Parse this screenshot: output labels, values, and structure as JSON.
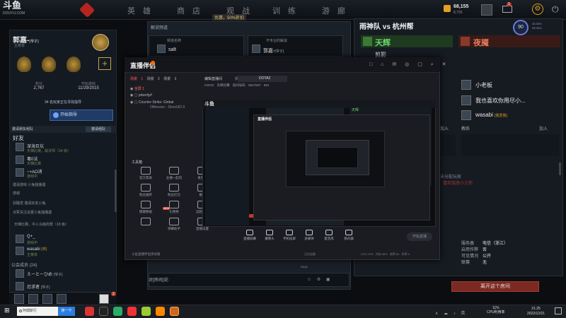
{
  "topbar": {
    "logo": "斗鱼",
    "logo_url": "DOUYU.COM",
    "nav": [
      "英 雄",
      "商 店",
      "观 战",
      "训 练",
      "游 廊"
    ],
    "notice": "优惠，50%折扣",
    "gold_value": "68,155",
    "gold_sub": "8,755",
    "settings_glyph": "⚙",
    "power_glyph": "⏻",
    "mail_count": "1"
  },
  "profile": {
    "name": "郭嘉-",
    "tag": "[爷子]",
    "subtitle": "主菜单",
    "stats": [
      {
        "label": "积分",
        "value": "2,767"
      },
      {
        "label": "开始游戏",
        "value": "11/29/2015"
      }
    ],
    "find_banner": "34 名玩家正在寻找指导",
    "coach_button": "开始指导",
    "friends_bar": "邀请朋友组队",
    "friends_button": "邀请组队",
    "friends_heading": "好友",
    "friends": [
      {
        "name": "深海巨坑",
        "status": "天梯比赛，敌法师（34 级）"
      },
      {
        "name": "毒0法",
        "status": "天梯比赛"
      },
      {
        "name": "~+AO消",
        "status": "游戏中"
      }
    ],
    "blurred": [
      "邀请游戏 小兔独播遇",
      "感谢",
      "别睡觉 邀请好友小兔",
      "点赞关注设置小兔独播遇"
    ],
    "friends_lower": [
      {
        "name": "Q+_",
        "status": "游戏中"
      },
      {
        "name": "wasabi",
        "tag": "[爷]",
        "status": "主菜单"
      }
    ],
    "party_label": "公会成员 (24)",
    "members": [
      {
        "name": "えーとーひめ",
        "tag": "[爷子]"
      },
      {
        "name": "忍求者",
        "tag": "[爷子]"
      }
    ],
    "lower_row": "天梯比赛，中入马级的帮（18 级）",
    "slot_badge": "2"
  },
  "lobby": {
    "title": "解说频道",
    "box1_label": "频道名称",
    "box1_value": "salt",
    "box2_label": "不专业的解说",
    "box2_value": "郭嘉-",
    "box2_tag": "[爷子]",
    "chat_label": "对[房间]说:",
    "chat_icons": "☺ ⚙ ▣"
  },
  "teams": {
    "match_title": "雨神队 vs 杭州帮",
    "radiant": "天辉",
    "dire": "夜魇",
    "radiant_player": "剪影",
    "score": "90",
    "score_side": [
      "36.98%",
      "98.06%"
    ],
    "dire_players": [
      {
        "name": "小老板",
        "tag": ""
      },
      {
        "name": "我也喜欢你用尽小...",
        "tag": ""
      },
      {
        "name": "wasabi",
        "tag": "[我爱我]"
      }
    ],
    "join_label": "加入",
    "coach_label": "教练",
    "unassigned": "未分配玩家",
    "unassigned_sub": "喜欢我改小三你",
    "info": [
      {
        "label": "服务器",
        "value": "电信（浙江）"
      },
      {
        "label": "启用作弊",
        "value": "否"
      },
      {
        "label": "可见情况",
        "value": "公开"
      },
      {
        "label": "联赛",
        "value": "无"
      }
    ],
    "leave_button": "离开这个房间"
  },
  "stream": {
    "logo": "直播伴侣",
    "window_icons": "□ ⌂ ✉ ◎ ▢ ⌕ ✕",
    "scene_tabs": [
      "场景 1",
      "场景 2",
      "场景 3"
    ],
    "room_label": "编辑直播间",
    "category_label": "频道",
    "category_value": "DOTA2",
    "fields": [
      "CSGO",
      "天梯比赛",
      "房间号码",
      "6617507",
      "591"
    ],
    "sources": [
      {
        "name": "全屏 1",
        "sub": ""
      },
      {
        "name": "pdwxfgrf",
        "sub": ""
      },
      {
        "name": "Counter-Strike: Global",
        "sub": "Offensive - Direct3D 9"
      }
    ],
    "tools_label": "工具箱",
    "tools": [
      "官方帮助",
      "主播一起玩",
      "发弹幕",
      "粉丝抽奖",
      "粉丝红包",
      "截图",
      "健康数据",
      "礼物秀",
      "远程控制",
      "",
      "弹幕助手",
      "直播设置"
    ],
    "tool_badge": "NEW",
    "beta_label": "斗鱼直播伴侣测试版",
    "controls": [
      "直播屏幕",
      "摄像头",
      "手机投屏",
      "多媒体",
      "麦克风",
      "扬声器"
    ],
    "live_button": "开始直播",
    "status": [
      "CPU:15%",
      "内存:58%",
      "帧率:60",
      "码率:0"
    ],
    "status2": "正在加载",
    "preview_logo": "斗鱼",
    "preview_radiant": "天辉",
    "preview_sub": "RAIN"
  },
  "taskbar": {
    "start_glyph": "⊞",
    "search_text": "阿姆斯行",
    "search_button": "搜一下",
    "ime": "中",
    "cpu_pct": "11%",
    "cpu_label": "CPU利用率",
    "time": "21:25",
    "date": "2022/12/21",
    "tray": "∧ ☁ ♪ 英"
  },
  "colors": {
    "radiant": "#6bd46a",
    "dire": "#e57a5c",
    "accent": "#e0a020",
    "leave": "#7a2a22"
  }
}
